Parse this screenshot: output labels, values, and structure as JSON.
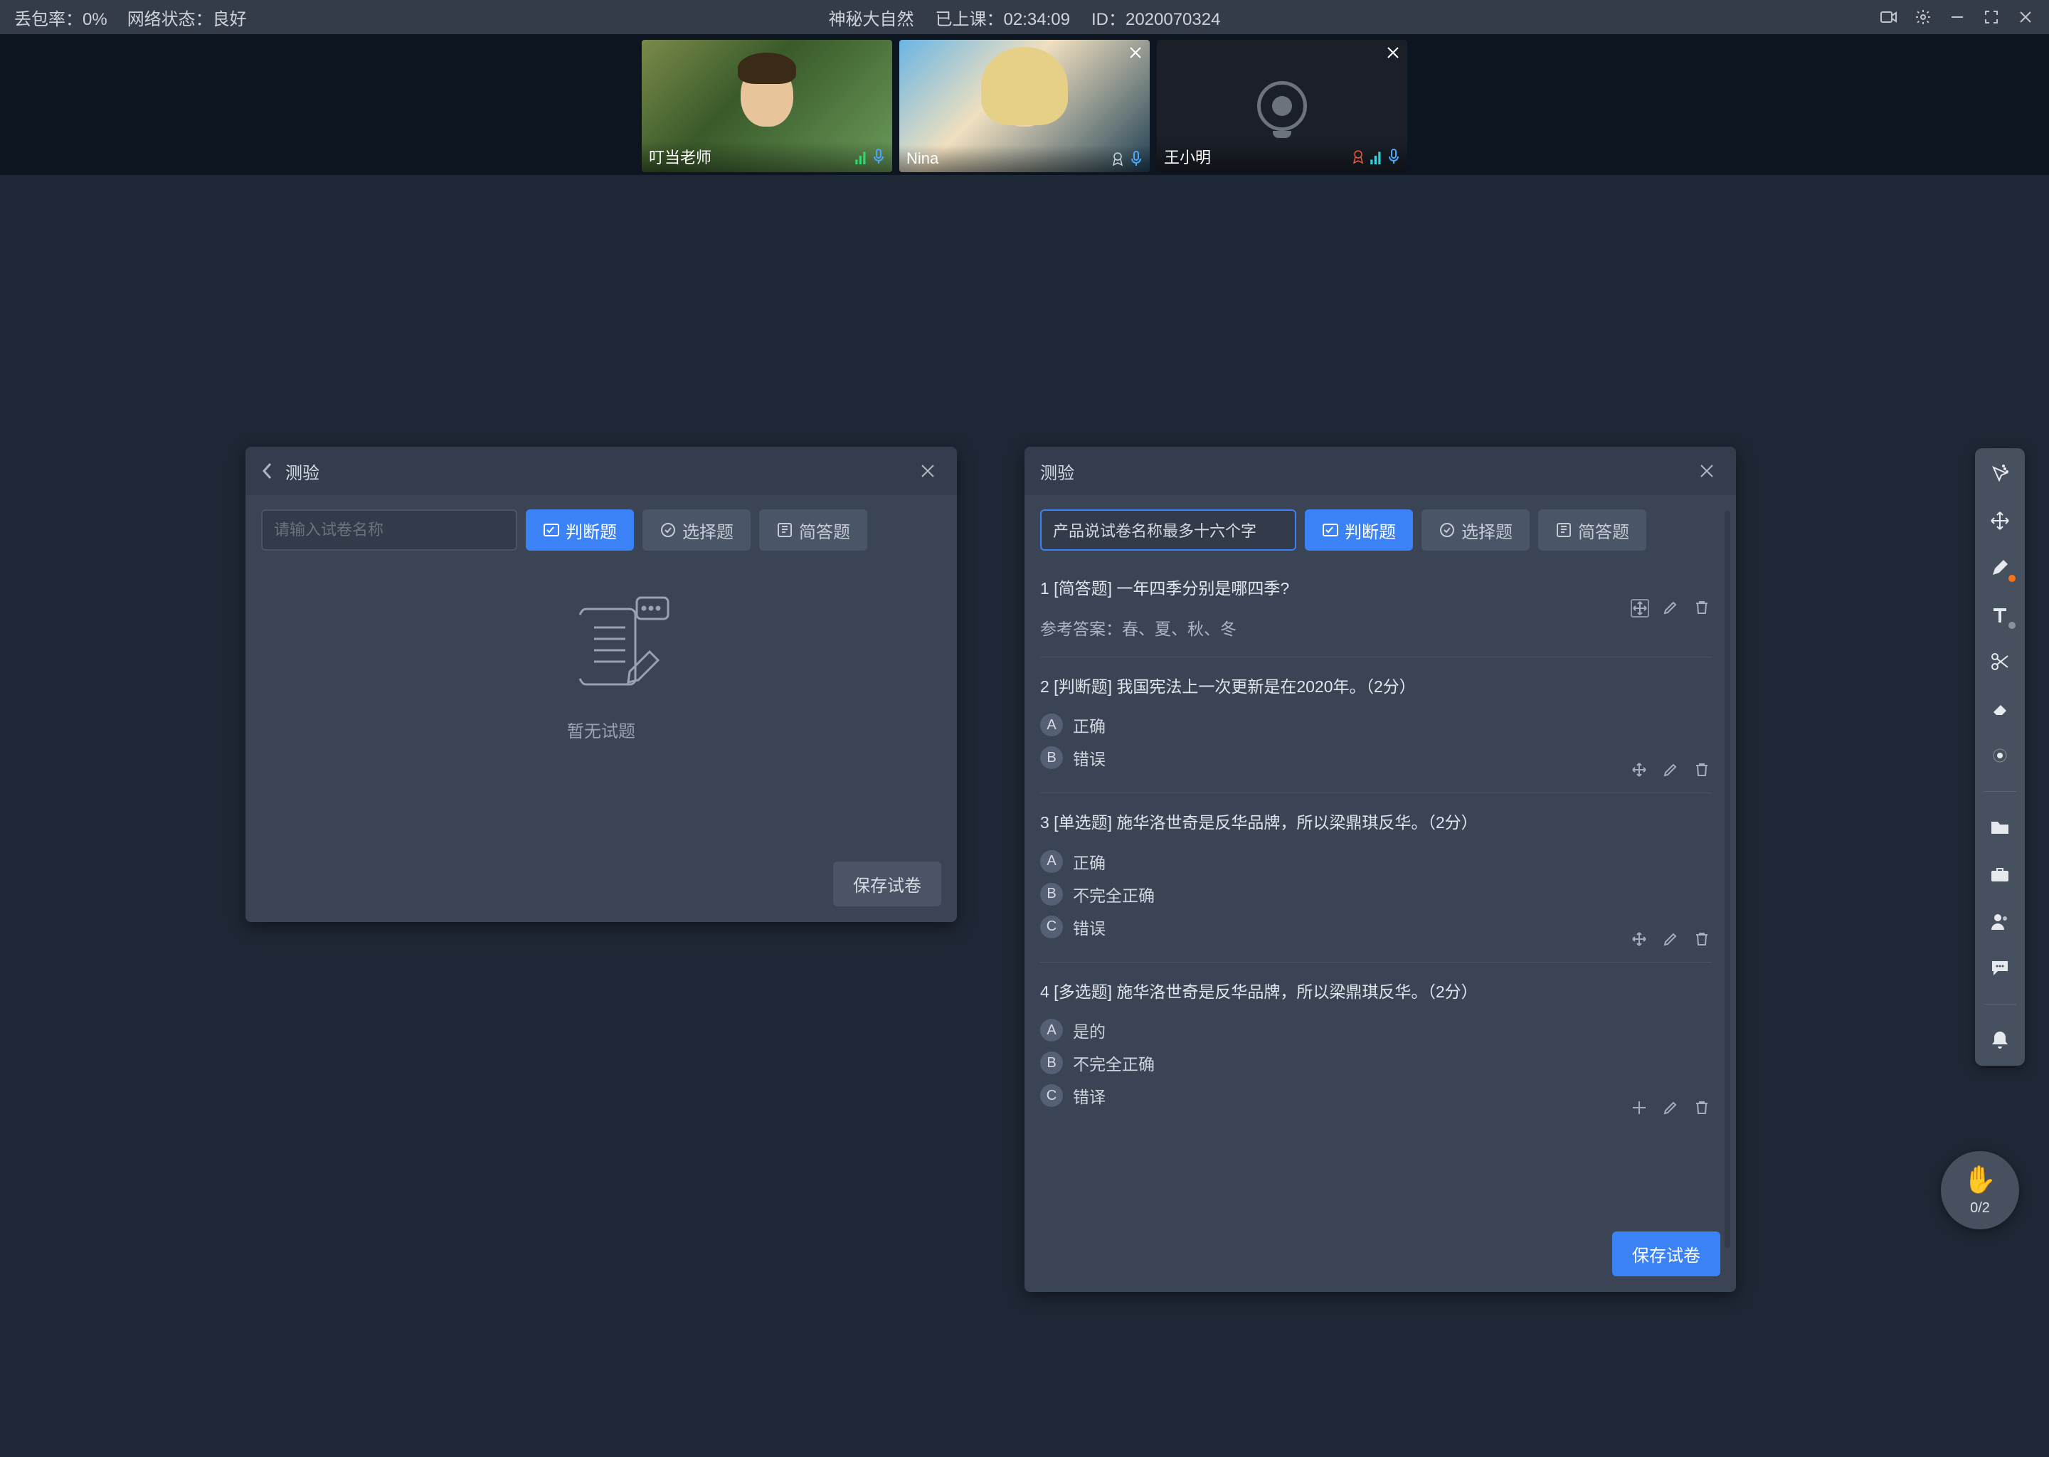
{
  "topbar": {
    "packet_loss_label": "丢包率：0%",
    "network_label": "网络状态：良好",
    "course_title": "神秘大自然",
    "elapsed_label": "已上课：02:34:09",
    "id_label": "ID：2020070324"
  },
  "participants": [
    {
      "name": "叮当老师",
      "role": "teacher",
      "mic": "on",
      "cam": "on"
    },
    {
      "name": "Nina",
      "role": "student",
      "mic": "on",
      "cam": "on"
    },
    {
      "name": "王小明",
      "role": "student",
      "mic": "on",
      "cam": "off"
    }
  ],
  "left_panel": {
    "title": "测验",
    "input_placeholder": "请输入试卷名称",
    "btn_judge": "判断题",
    "btn_choice": "选择题",
    "btn_short": "简答题",
    "empty_text": "暂无试题",
    "save_label": "保存试卷"
  },
  "right_panel": {
    "title": "测验",
    "quiz_name": "产品说试卷名称最多十六个字",
    "btn_judge": "判断题",
    "btn_choice": "选择题",
    "btn_short": "简答题",
    "save_label": "保存试卷",
    "questions": [
      {
        "index": "1",
        "header": "1 [简答题] 一年四季分别是哪四季?",
        "ref_answer": "参考答案：春、夏、秋、冬",
        "options": []
      },
      {
        "index": "2",
        "header": "2 [判断题] 我国宪法上一次更新是在2020年。（2分）",
        "options": [
          {
            "letter": "A",
            "text": "正确"
          },
          {
            "letter": "B",
            "text": "错误"
          }
        ]
      },
      {
        "index": "3",
        "header": "3 [单选题] 施华洛世奇是反华品牌，所以梁鼎琪反华。（2分）",
        "options": [
          {
            "letter": "A",
            "text": "正确"
          },
          {
            "letter": "B",
            "text": "不完全正确"
          },
          {
            "letter": "C",
            "text": "错误"
          }
        ]
      },
      {
        "index": "4",
        "header": "4 [多选题] 施华洛世奇是反华品牌，所以梁鼎琪反华。（2分）",
        "options": [
          {
            "letter": "A",
            "text": "是的"
          },
          {
            "letter": "B",
            "text": "不完全正确"
          },
          {
            "letter": "C",
            "text": "错译"
          }
        ]
      }
    ]
  },
  "hand": {
    "count": "0/2"
  }
}
